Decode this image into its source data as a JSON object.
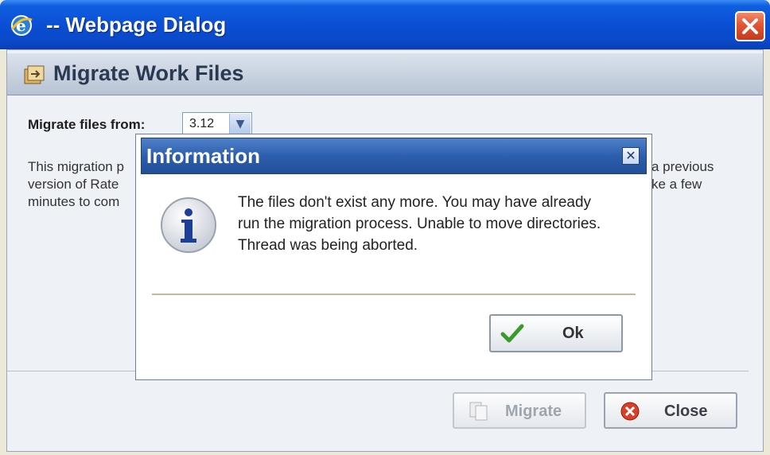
{
  "window": {
    "title": "-- Webpage Dialog"
  },
  "header": {
    "title": "Migrate Work Files"
  },
  "form": {
    "from_label": "Migrate files from:",
    "from_value": "3.12",
    "desc_left": "This migration p\nversion of Rate\nminutes to com",
    "desc_right": "a previous\nke a few"
  },
  "buttons": {
    "migrate_label": "Migrate",
    "close_label": "Close"
  },
  "modal": {
    "title": "Information",
    "message": "The files don't exist any more. You may have already run the migration process. Unable to move directories. Thread was being aborted.",
    "ok_label": "Ok"
  },
  "colors": {
    "titlebar": "#0b4fd4",
    "modal_titlebar": "#2c5fae",
    "close_red": "#e25434"
  }
}
